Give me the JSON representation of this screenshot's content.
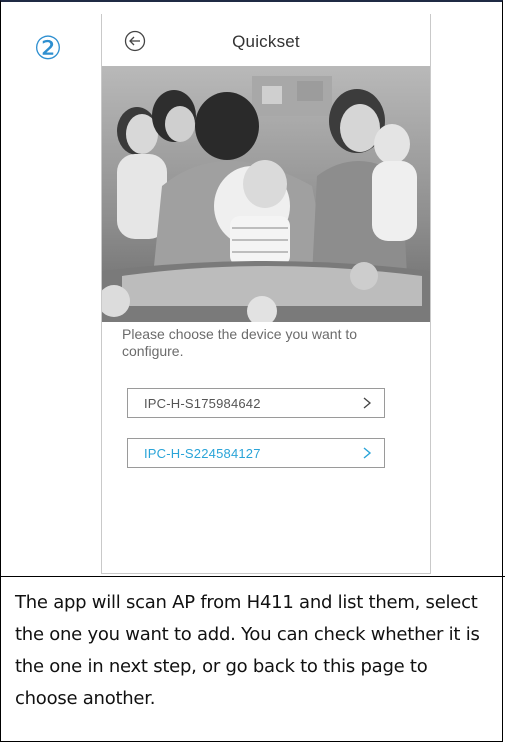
{
  "step_marker": "②",
  "header": {
    "title": "Quickset",
    "back_icon": "arrow-left-circle-icon"
  },
  "hero": {
    "style": "grayscale family photo"
  },
  "prompt": "Please choose the device you want to configure.",
  "devices": [
    {
      "name": "IPC-H-S175984642",
      "selected": false
    },
    {
      "name": "IPC-H-S224584127",
      "selected": true
    }
  ],
  "caption": "The app will scan AP from H411 and list them, select the one you want to add. You can check whether it is the one in next step, or go back to this page to choose another.",
  "colors": {
    "accent": "#2aa4d8",
    "marker": "#2e8fd0",
    "text_gray": "#6b6b6b",
    "border": "#9a9a9a"
  }
}
